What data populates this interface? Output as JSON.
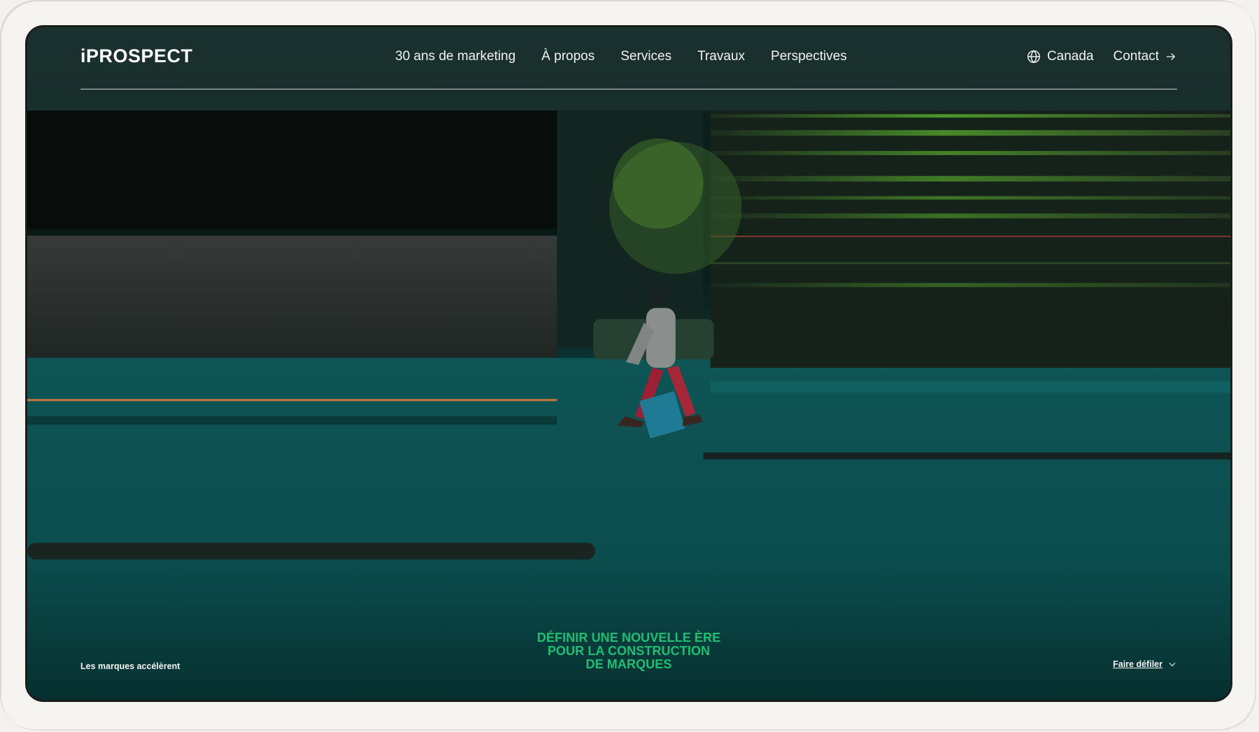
{
  "header": {
    "logo": "iPROSPECT",
    "nav_items": [
      "30 ans de marketing",
      "À propos",
      "Services",
      "Travaux",
      "Perspectives"
    ],
    "region": "Canada",
    "contact": "Contact"
  },
  "hero": {
    "headline_lines": [
      "DÉFINIR UNE NOUVELLE ÈRE",
      "POUR LA CONSTRUCTION",
      "DE MARQUES"
    ],
    "left_caption": "Les marques accélèrent",
    "scroll_label": "Faire défiler"
  },
  "colors": {
    "accent_green": "#1fbf73",
    "teal": "#0d4b4d",
    "nav_text": "#f1f3f2"
  },
  "icons": {
    "region": "globe-icon",
    "contact": "arrow-right-icon",
    "scroll": "chevron-down-icon"
  }
}
